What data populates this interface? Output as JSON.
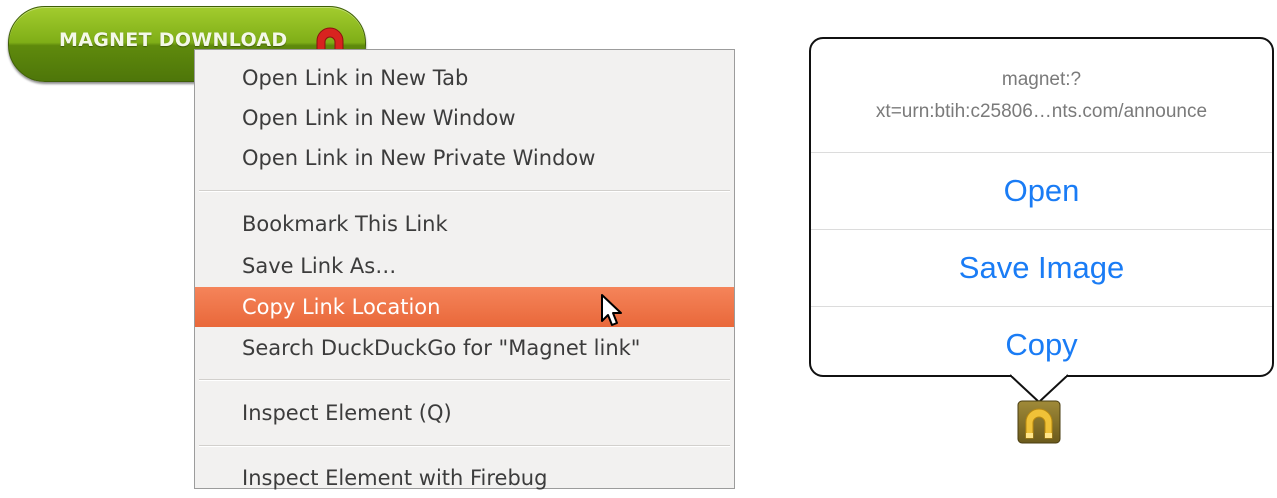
{
  "magnet_button": {
    "label": "MAGNET DOWNLOAD",
    "icon": "magnet-icon",
    "color": "#7fae17"
  },
  "context_menu": {
    "items": [
      {
        "label": "Open Link in New Tab",
        "group": 1
      },
      {
        "label": "Open Link in New Window",
        "group": 1
      },
      {
        "label": "Open Link in New Private Window",
        "group": 1
      },
      {
        "label": "Bookmark This Link",
        "group": 2
      },
      {
        "label": "Save Link As…",
        "group": 2
      },
      {
        "label": "Copy Link Location",
        "group": 2,
        "highlighted": true
      },
      {
        "label": "Search DuckDuckGo for \"Magnet link\"",
        "group": 2
      },
      {
        "label": "Inspect Element (Q)",
        "group": 3
      },
      {
        "label": "Inspect Element with Firebug",
        "group": 4
      }
    ],
    "highlight_color": "#e9683a",
    "cursor_icon": "arrow-cursor-icon"
  },
  "ios_popover": {
    "url_line1": "magnet:?",
    "url_line2": "xt=urn:btih:c25806…nts.com/announce",
    "actions": [
      "Open",
      "Save Image",
      "Copy"
    ],
    "action_color": "#1a7cf5",
    "anchor_icon": "magnet-app-icon"
  }
}
